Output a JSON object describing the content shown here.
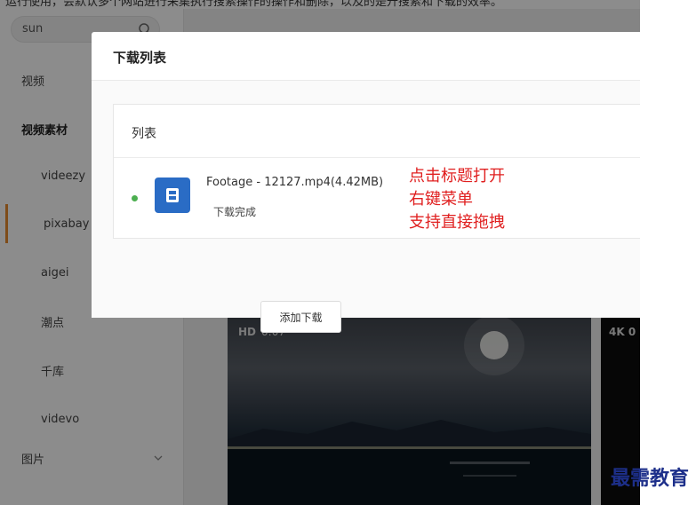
{
  "caption": "运行使用，会默认多个网站进行采集执行搜索操作的操作和删除，以及的是升搜索和下载的效率。",
  "search": {
    "value": "sun"
  },
  "sidebar": {
    "items": [
      {
        "label": "视频"
      },
      {
        "label": "视频素材"
      },
      {
        "label": "videezy"
      },
      {
        "label": "pixabay"
      },
      {
        "label": "aigei"
      },
      {
        "label": "潮点"
      },
      {
        "label": "千库"
      },
      {
        "label": "videvo"
      },
      {
        "label": "图片"
      }
    ]
  },
  "videos": [
    {
      "quality": "HD",
      "duration": "0:07"
    },
    {
      "quality": "4K",
      "duration": "0"
    }
  ],
  "modal": {
    "title": "下载列表",
    "list_title": "列表",
    "item": {
      "file_name": "Footage - 12127.mp4(4.42MB)",
      "status": "下载完成"
    },
    "annotation": [
      "点击标题打开",
      "右键菜单",
      "支持直接拖拽"
    ],
    "add_button": "添加下载"
  },
  "watermark": "最需教育",
  "colors": {
    "accent": "#e68a2e",
    "file_icon": "#2a6cc5",
    "status_dot": "#4caf50",
    "annotation": "#e02020",
    "watermark": "#1d2f8a"
  }
}
